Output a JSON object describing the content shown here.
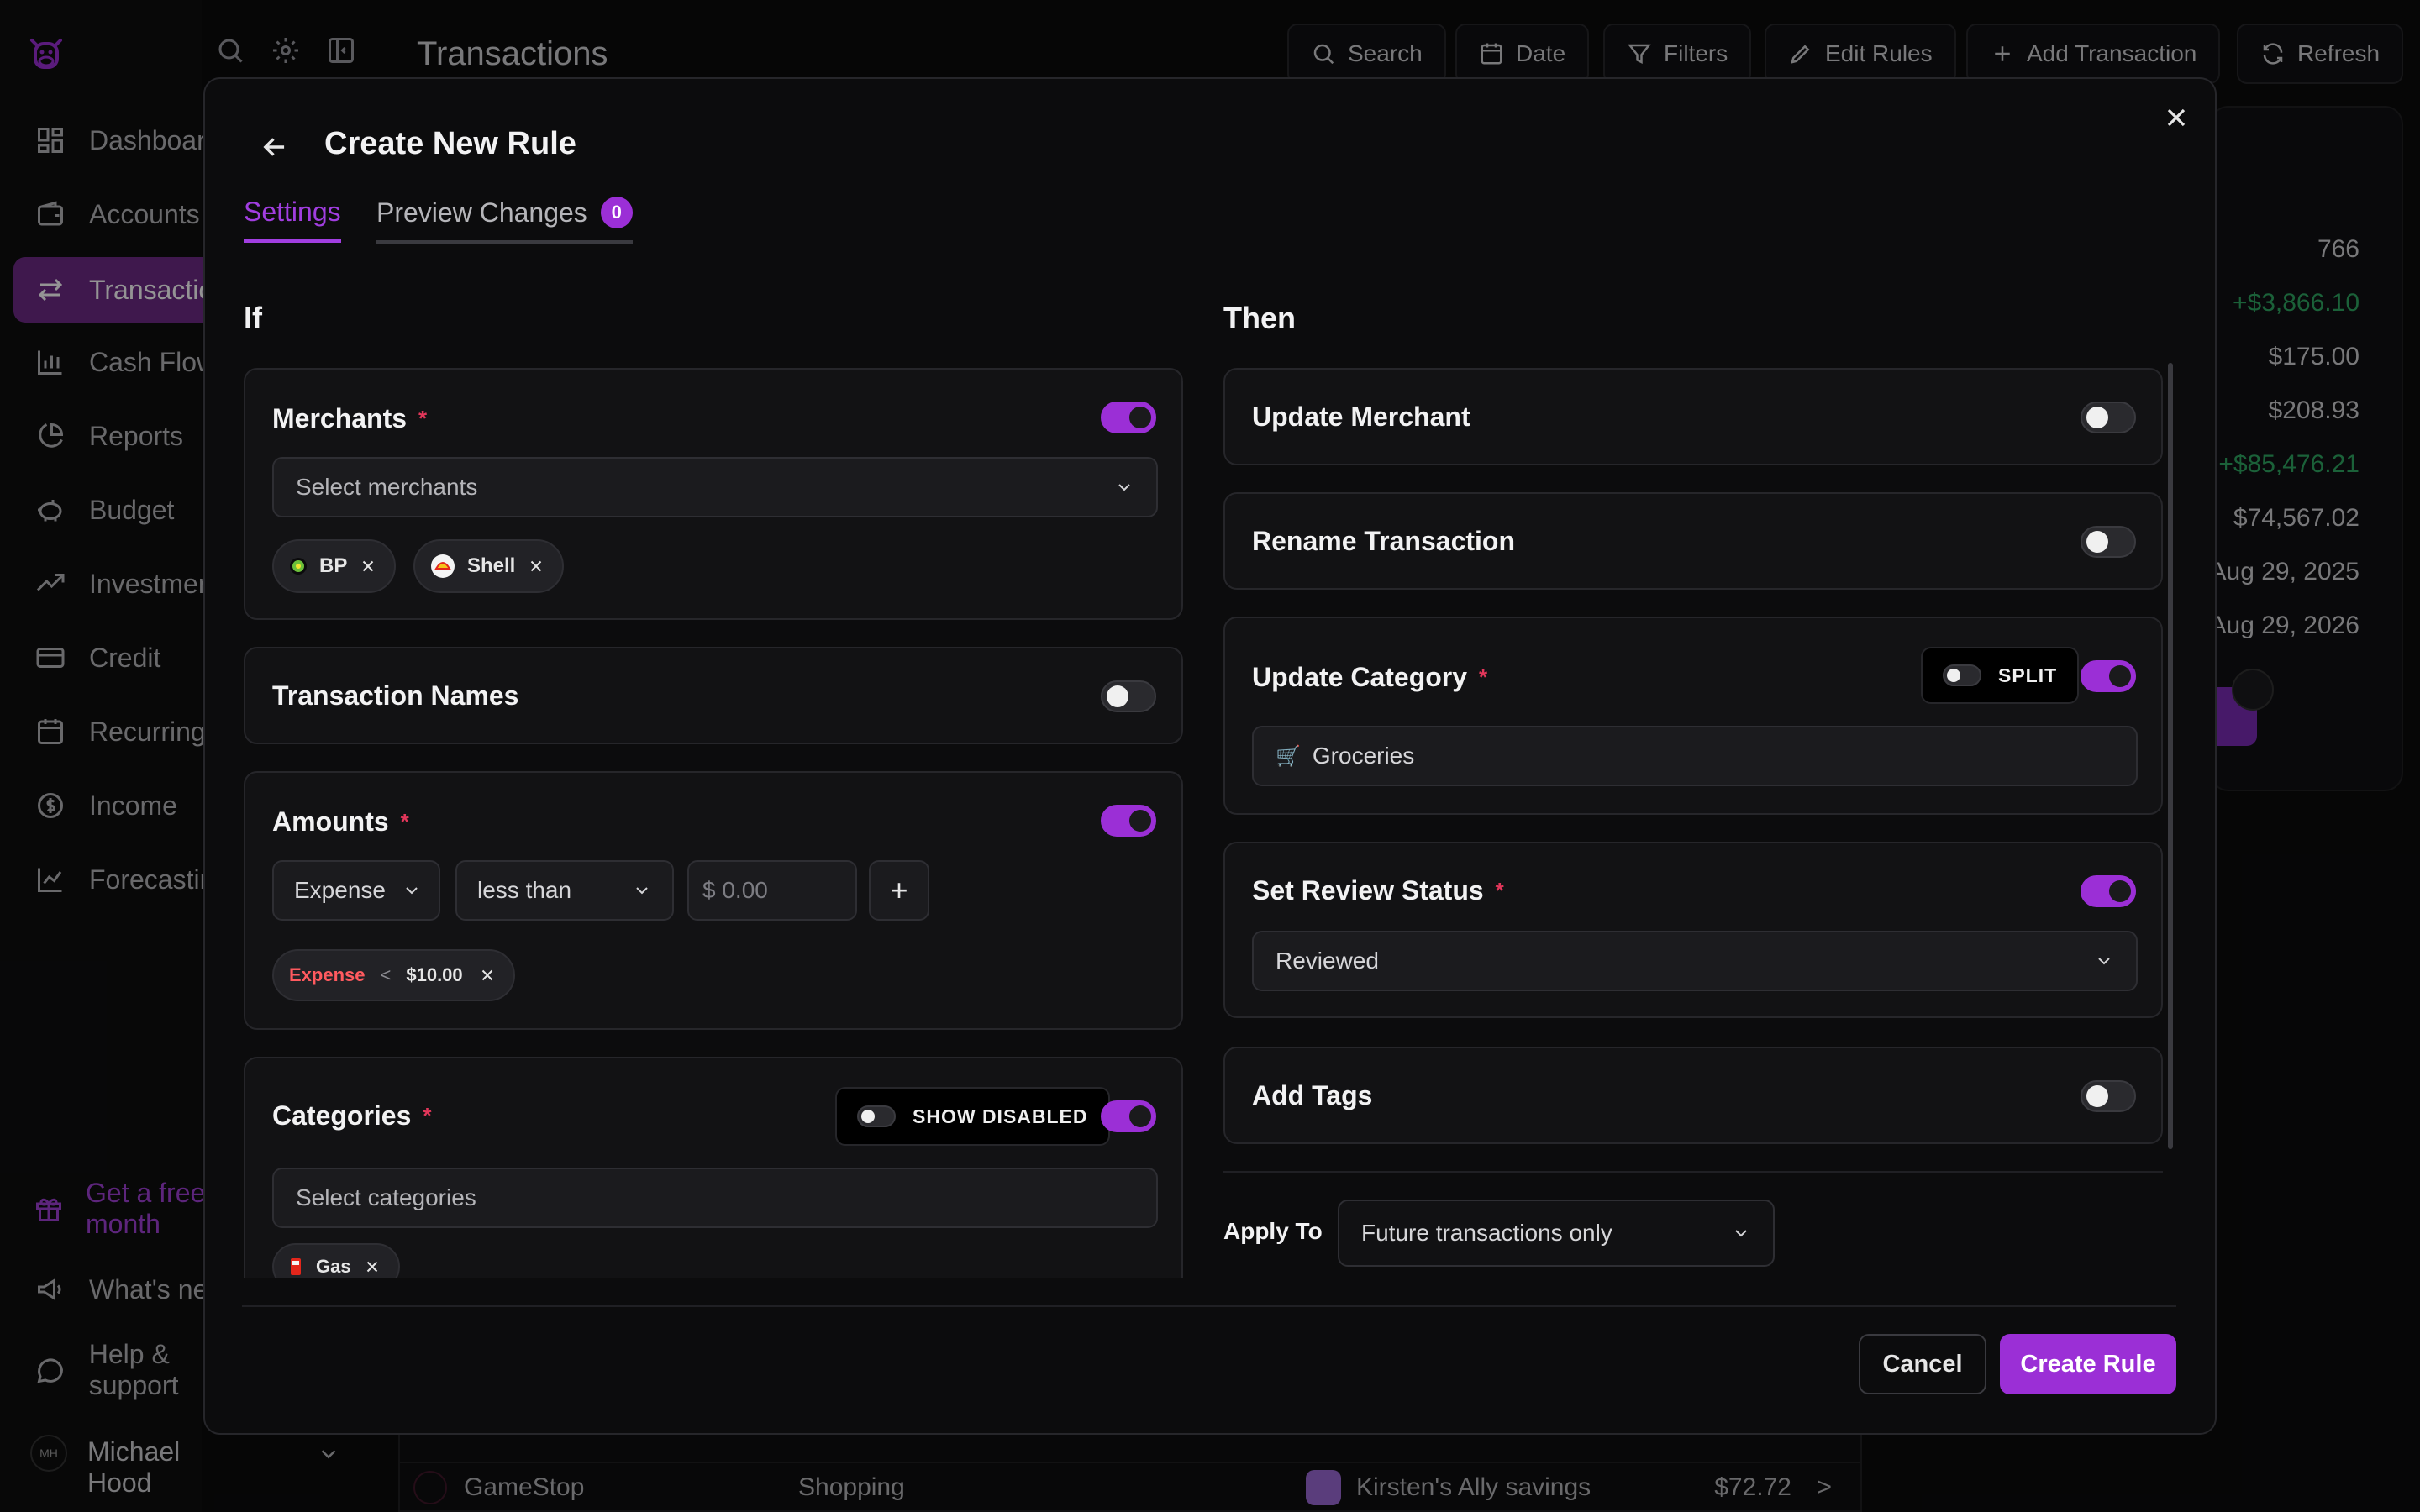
{
  "app": {
    "page_title": "Transactions",
    "nav": [
      {
        "label": "Dashboard",
        "icon": "dashboard-icon"
      },
      {
        "label": "Accounts",
        "icon": "wallet-icon"
      },
      {
        "label": "Transactions",
        "icon": "transfer-icon"
      },
      {
        "label": "Cash Flow",
        "icon": "bar-chart-icon"
      },
      {
        "label": "Reports",
        "icon": "pie-chart-icon"
      },
      {
        "label": "Budget",
        "icon": "piggy-bank-icon"
      },
      {
        "label": "Investments",
        "icon": "trending-up-icon"
      },
      {
        "label": "Credit",
        "icon": "credit-card-icon"
      },
      {
        "label": "Recurring",
        "icon": "calendar-icon"
      },
      {
        "label": "Income",
        "icon": "dollar-icon"
      },
      {
        "label": "Forecasting",
        "icon": "line-chart-icon"
      }
    ],
    "promo": "Get a free month",
    "whats_new": "What's new",
    "help": "Help & support",
    "user": {
      "initials": "MH",
      "name": "Michael Hood"
    },
    "toolbar": {
      "search": "Search",
      "date": "Date",
      "filters": "Filters",
      "edit_rules": "Edit Rules",
      "add_transaction": "Add Transaction",
      "refresh": "Refresh"
    },
    "summary_values": [
      "766",
      "+$3,866.10",
      "$175.00",
      "$208.93",
      "+$85,476.21",
      "$74,567.02",
      "Aug 29, 2025",
      "Aug 29, 2026"
    ],
    "bg_row": {
      "merchant": "GameStop",
      "category": "Shopping",
      "account": "Kirsten's Ally savings",
      "amount": "$72.72",
      "arrow": ">"
    }
  },
  "modal": {
    "title": "Create New Rule",
    "tabs": {
      "settings": "Settings",
      "preview": "Preview Changes",
      "preview_count": "0"
    },
    "if_heading": "If",
    "then_heading": "Then",
    "merchants": {
      "title": "Merchants",
      "required": "*",
      "enabled": true,
      "placeholder": "Select merchants",
      "chips": [
        "BP",
        "Shell"
      ]
    },
    "transaction_names": {
      "title": "Transaction Names",
      "enabled": false
    },
    "amounts": {
      "title": "Amounts",
      "required": "*",
      "enabled": true,
      "type": "Expense",
      "operator": "less than",
      "currency": "$",
      "amount_placeholder": "0.00",
      "add": "+",
      "chip": {
        "type": "Expense",
        "op": "<",
        "value": "$10.00"
      }
    },
    "categories": {
      "title": "Categories",
      "required": "*",
      "show_disabled": "SHOW DISABLED",
      "enabled": true,
      "placeholder": "Select categories",
      "chips": [
        "Gas"
      ]
    },
    "update_merchant": {
      "title": "Update Merchant",
      "enabled": false
    },
    "rename_transaction": {
      "title": "Rename Transaction",
      "enabled": false
    },
    "update_category": {
      "title": "Update Category",
      "required": "*",
      "split": "SPLIT",
      "enabled": true,
      "value": "Groceries",
      "emoji": "🛒"
    },
    "review_status": {
      "title": "Set Review Status",
      "required": "*",
      "enabled": true,
      "value": "Reviewed"
    },
    "add_tags": {
      "title": "Add Tags",
      "enabled": false
    },
    "apply_to": {
      "label": "Apply To",
      "value": "Future transactions only"
    },
    "cancel": "Cancel",
    "create": "Create Rule",
    "colors": {
      "accent": "#9b2fd6",
      "required": "#e2365a",
      "expense": "#ff5a5f",
      "positive": "#2fa862"
    }
  }
}
